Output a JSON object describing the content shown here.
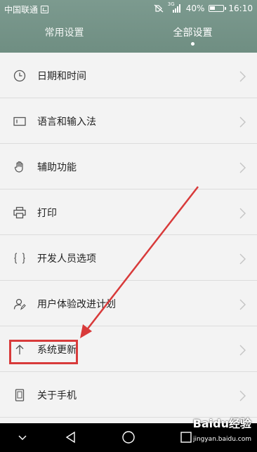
{
  "status_bar": {
    "carrier": "中国联通",
    "network": "3G",
    "battery": "40%",
    "battery_level": 0.4,
    "time": "16:10"
  },
  "tabs": [
    {
      "label": "常用设置",
      "active": false
    },
    {
      "label": "全部设置",
      "active": true
    }
  ],
  "settings_items": [
    {
      "label": "日期和时间",
      "icon": "clock-icon"
    },
    {
      "label": "语言和输入法",
      "icon": "keyboard-icon"
    },
    {
      "label": "辅助功能",
      "icon": "hand-icon"
    },
    {
      "label": "打印",
      "icon": "printer-icon"
    },
    {
      "label": "开发人员选项",
      "icon": "braces-icon"
    },
    {
      "label": "用户体验改进计划",
      "icon": "user-icon"
    },
    {
      "label": "系统更新",
      "icon": "arrow-up-icon",
      "highlighted": true
    },
    {
      "label": "关于手机",
      "icon": "phone-icon"
    }
  ],
  "nav_bar": {
    "buttons": [
      "chevron-down-icon",
      "back-triangle-icon",
      "home-circle-icon",
      "recent-square-icon"
    ]
  },
  "watermark": {
    "brand": "Baidu经验",
    "url": "jingyan.baidu.com"
  },
  "colors": {
    "header": "#6f8e82",
    "highlight": "#d83a3a",
    "background": "#f3f3f3"
  }
}
